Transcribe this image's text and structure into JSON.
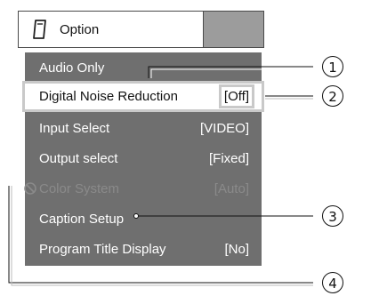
{
  "header": {
    "title": "Option"
  },
  "menu": {
    "items": [
      {
        "label": "Audio Only",
        "value": ""
      },
      {
        "label": "Digital Noise Reduction",
        "value": "[Off]"
      },
      {
        "label": "Input Select",
        "value": "[VIDEO]"
      },
      {
        "label": "Output select",
        "value": "[Fixed]"
      },
      {
        "label": "Color System",
        "value": "[Auto]"
      },
      {
        "label": "Caption Setup",
        "value": ""
      },
      {
        "label": "Program Title Display",
        "value": "[No]"
      }
    ]
  },
  "callouts": [
    "1",
    "2",
    "3",
    "4"
  ],
  "icons": {
    "header": "remote-pad-icon",
    "disabled": "prohibited-icon"
  }
}
